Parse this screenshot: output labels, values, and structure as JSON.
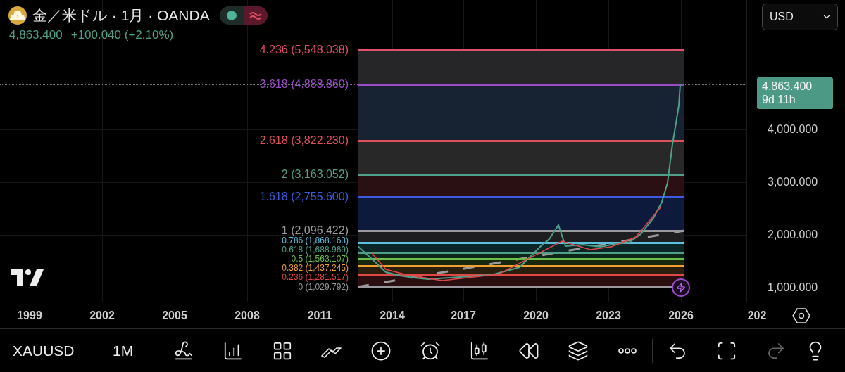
{
  "header": {
    "symbol_title": "金／米ドル · 1月 · OANDA",
    "price": "4,863.400",
    "change": "+100.040 (+2.10%)"
  },
  "currency_select": {
    "value": "USD"
  },
  "fib_levels": [
    {
      "label": "4.236 (5,548.038)",
      "color": "#e0506a"
    },
    {
      "label": "3.618 (4,888.860)",
      "color": "#9a4cc8"
    },
    {
      "label": "2.618 (3,822.230)",
      "color": "#e0505a"
    },
    {
      "label": "2 (3,163.052)",
      "color": "#4fa08a"
    },
    {
      "label": "1.618 (2,755.600)",
      "color": "#3d5be0"
    },
    {
      "label": "1 (2,096.422)",
      "color": "#9a9a9e"
    },
    {
      "label": "0.786 (1,868.163)",
      "color": "#5bbfe0"
    },
    {
      "label": "0.618 (1,688.969)",
      "color": "#4fa08a"
    },
    {
      "label": "0.5 (1,563.107)",
      "color": "#6cc04a"
    },
    {
      "label": "0.382 (1,437.245)",
      "color": "#f0a030"
    },
    {
      "label": "0.236 (1,281.517)",
      "color": "#e04848"
    },
    {
      "label": "0 (1,029.792)",
      "color": "#9a9a9e"
    }
  ],
  "price_axis": [
    "4,000.000",
    "3,000.000",
    "2,000.000",
    "1,000.000"
  ],
  "last_price": {
    "price": "4,863.400",
    "countdown": "9d 11h"
  },
  "time_axis": [
    "1999",
    "2002",
    "2005",
    "2008",
    "2011",
    "2014",
    "2017",
    "2020",
    "2023",
    "2026",
    "202"
  ],
  "bottom_bar": {
    "symbol": "XAUUSD",
    "interval": "1M"
  }
}
